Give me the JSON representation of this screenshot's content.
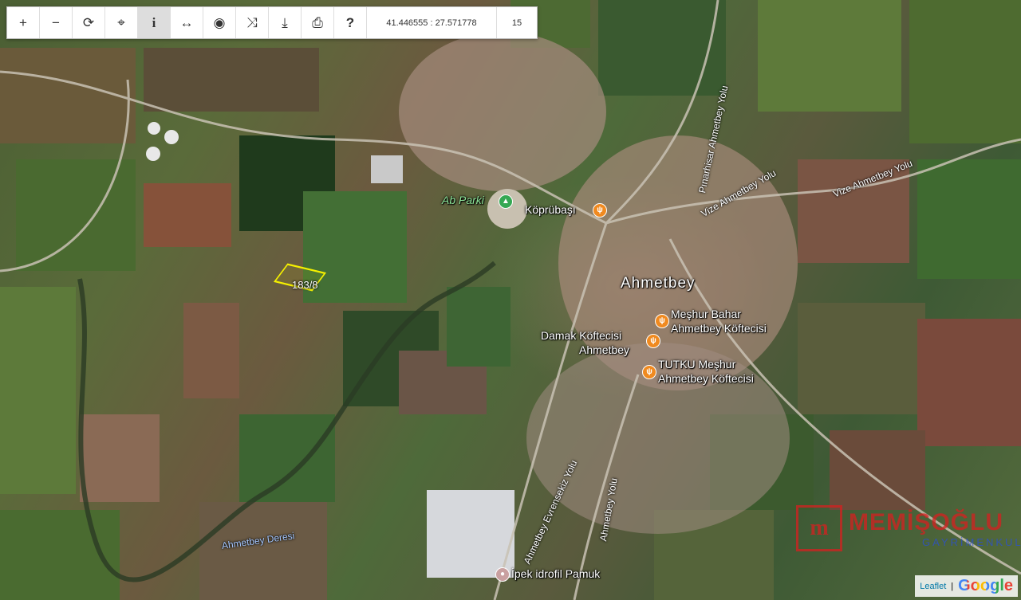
{
  "toolbar": {
    "buttons": [
      {
        "name": "zoom-in-button",
        "icon": "plus-icon",
        "glyph": "+"
      },
      {
        "name": "zoom-out-button",
        "icon": "minus-icon",
        "glyph": "−"
      },
      {
        "name": "refresh-button",
        "icon": "refresh-icon",
        "glyph": "⟳"
      },
      {
        "name": "locate-button",
        "icon": "crosshair-icon",
        "glyph": "⌖"
      },
      {
        "name": "info-button",
        "icon": "info-icon",
        "glyph": "i"
      },
      {
        "name": "measure-button",
        "icon": "measure-icon",
        "glyph": "↔"
      },
      {
        "name": "view-button",
        "icon": "eye-icon",
        "glyph": "◉"
      },
      {
        "name": "shuffle-button",
        "icon": "shuffle-icon",
        "glyph": "⤨"
      },
      {
        "name": "download-button",
        "icon": "download-icon",
        "glyph": "⤓"
      },
      {
        "name": "print-button",
        "icon": "printer-icon",
        "glyph": "⎙"
      },
      {
        "name": "help-button",
        "icon": "help-icon",
        "glyph": "?"
      }
    ],
    "coordinates": "41.446555 : 27.571778",
    "zoom": "15"
  },
  "places": {
    "town": "Ahmetbey",
    "park": "Ab Parki",
    "bridge": "Köprübaşı",
    "poi_1": "Meşhur Bahar",
    "poi_1b": "Ahmetbey Köftecisi",
    "poi_2": "Damak Köftecisi",
    "poi_2b": "Ahmetbey",
    "poi_3": "TUTKU Meşhur",
    "poi_3b": "Ahmetbey Köftecisi",
    "factory": "İpek idrofil Pamuk"
  },
  "roads": {
    "r1": "Pınarhisar Ahmetbey Yolu",
    "r2": "Vize Ahmetbey Yolu",
    "r3": "Vize Ahmetbey Yolu",
    "r4": "Ahmetbey Evrensekiz Yolu",
    "r5": "Ahmetbey Yolu",
    "river": "Ahmetbey Deresi"
  },
  "parcel": {
    "label": "183/8"
  },
  "brand": {
    "name": "MEMİŞOĞLU",
    "sub": "GAYRİMENKUL",
    "logo": "m"
  },
  "attribution": {
    "leaflet": "Leaflet",
    "google": "Google"
  }
}
